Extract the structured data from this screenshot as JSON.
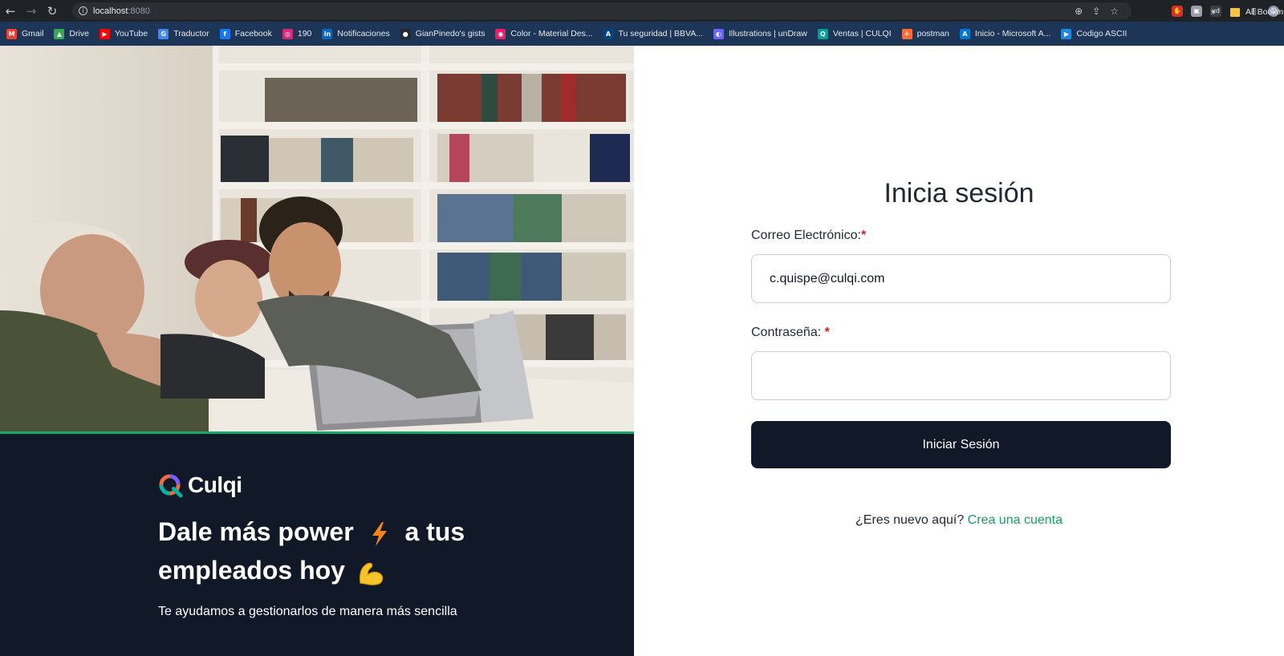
{
  "browser": {
    "url_host": "localhost",
    "url_port": ":8080",
    "bookmarks": [
      {
        "label": "Gmail",
        "icon": "gmail-icon",
        "color": "#ea4335",
        "glyph": "M"
      },
      {
        "label": "Drive",
        "icon": "drive-icon",
        "color": "#34a853",
        "glyph": "▲"
      },
      {
        "label": "YouTube",
        "icon": "youtube-icon",
        "color": "#ff0000",
        "glyph": "▶"
      },
      {
        "label": "Traductor",
        "icon": "translate-icon",
        "color": "#4285f4",
        "glyph": "G"
      },
      {
        "label": "Facebook",
        "icon": "facebook-icon",
        "color": "#1877f2",
        "glyph": "f"
      },
      {
        "label": "190",
        "icon": "instagram-icon",
        "color": "#d62976",
        "glyph": "◎"
      },
      {
        "label": "Notificaciones",
        "icon": "linkedin-icon",
        "color": "#0a66c2",
        "glyph": "in"
      },
      {
        "label": "GianPinedo's gists",
        "icon": "github-icon",
        "color": "#24292e",
        "glyph": "●"
      },
      {
        "label": "Color - Material Des...",
        "icon": "material-icon",
        "color": "#e91e63",
        "glyph": "◉"
      },
      {
        "label": "Tu seguridad | BBVA...",
        "icon": "bbva-icon",
        "color": "#004481",
        "glyph": "A"
      },
      {
        "label": "Illustrations | unDraw",
        "icon": "undraw-icon",
        "color": "#6c63ff",
        "glyph": "◐"
      },
      {
        "label": "Ventas | CULQI",
        "icon": "culqi-icon",
        "color": "#00a19b",
        "glyph": "Q"
      },
      {
        "label": "postman",
        "icon": "postman-icon",
        "color": "#ff6c37",
        "glyph": "✈"
      },
      {
        "label": "Inicio - Microsoft A...",
        "icon": "azure-icon",
        "color": "#0078d4",
        "glyph": "A"
      },
      {
        "label": "Codigo ASCII",
        "icon": "ascii-icon",
        "color": "#1e88e5",
        "glyph": "▶"
      }
    ],
    "more_bookmarks": "»",
    "all_bookmarks": "All Bookm"
  },
  "left": {
    "brand": "Culqi",
    "headline_part1": "Dale más power",
    "headline_part2": "a tus empleados hoy",
    "subtitle": "Te ayudamos a gestionarlos de manera más sencilla",
    "accent_color": "#1aa86a"
  },
  "form": {
    "title": "Inicia sesión",
    "email_label": "Correo Electrónico:",
    "email_value": "c.quispe@culqi.com",
    "password_label": "Contraseña: ",
    "required_mark": "*",
    "submit_label": "Iniciar Sesión",
    "register_prompt": "¿Eres nuevo aquí?",
    "register_link": "Crea una cuenta"
  }
}
